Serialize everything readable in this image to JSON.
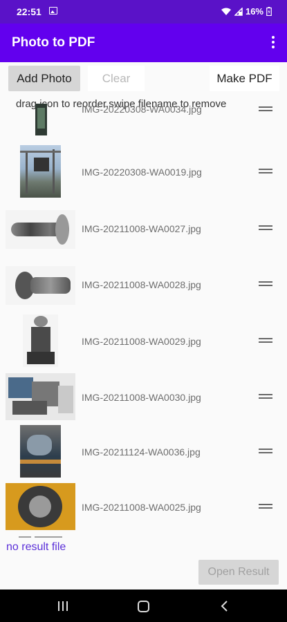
{
  "status_bar": {
    "time": "22:51",
    "battery": "16%"
  },
  "app_bar": {
    "title": "Photo to PDF"
  },
  "toolbar": {
    "add_label": "Add Photo",
    "clear_label": "Clear",
    "make_label": "Make PDF"
  },
  "hint": "drag icon to reorder,swipe filename to remove",
  "photos": [
    {
      "filename": "IMG-20220308-WA0034.jpg"
    },
    {
      "filename": "IMG-20220308-WA0019.jpg"
    },
    {
      "filename": "IMG-20211008-WA0027.jpg"
    },
    {
      "filename": "IMG-20211008-WA0028.jpg"
    },
    {
      "filename": "IMG-20211008-WA0029.jpg"
    },
    {
      "filename": "IMG-20211008-WA0030.jpg"
    },
    {
      "filename": "IMG-20211124-WA0036.jpg"
    },
    {
      "filename": "IMG-20211008-WA0025.jpg"
    }
  ],
  "result": {
    "status": "no result file",
    "open_label": "Open Result"
  },
  "colors": {
    "status_bar": "#5a12c8",
    "app_bar": "#6200ee",
    "accent_text": "#5a2ed8"
  }
}
